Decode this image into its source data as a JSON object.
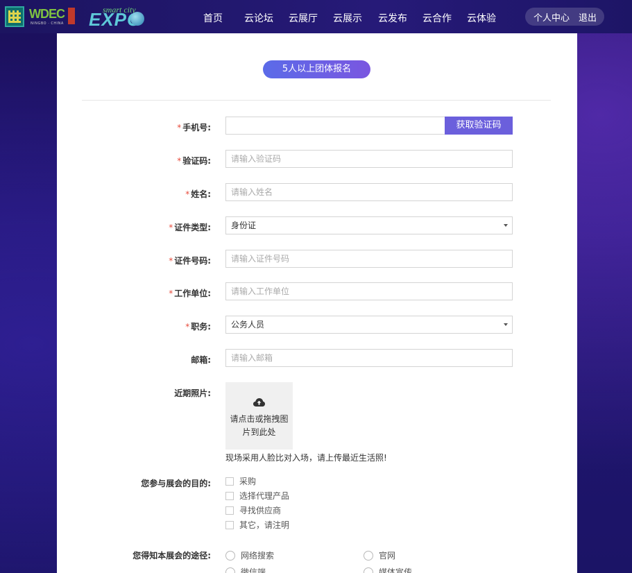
{
  "header": {
    "logo_wdec_text": "WDEC",
    "logo_wdec_sub": "NINGBO · CHINA",
    "logo_expo_small": "smart city",
    "logo_expo_text": "EXPO",
    "nav": [
      "首页",
      "云论坛",
      "云展厅",
      "云展示",
      "云发布",
      "云合作",
      "云体验"
    ],
    "user_center": "个人中心",
    "logout": "退出"
  },
  "form": {
    "title": "5人以上团体报名",
    "required_mark": "*",
    "phone_label": "手机号:",
    "phone_value": "",
    "get_code_button": "获取验证码",
    "code_label": "验证码:",
    "code_placeholder": "请输入验证码",
    "name_label": "姓名:",
    "name_placeholder": "请输入姓名",
    "id_type_label": "证件类型:",
    "id_type_value": "身份证",
    "id_number_label": "证件号码:",
    "id_number_placeholder": "请输入证件号码",
    "employer_label": "工作单位:",
    "employer_placeholder": "请输入工作单位",
    "position_label": "职务:",
    "position_value": "公务人员",
    "email_label": "邮箱:",
    "email_placeholder": "请输入邮箱",
    "photo_label": "近期照片:",
    "upload_text": "请点击或拖拽图片到此处",
    "photo_hint": "现场采用人脸比对入场，请上传最近生活照!",
    "purpose_label": "您参与展会的目的:",
    "purpose_options": [
      "采购",
      "选择代理产品",
      "寻找供应商",
      "其它，请注明"
    ],
    "source_label": "您得知本展会的途径:",
    "source_options": [
      "网络搜索",
      "官网",
      "微信端",
      "媒体宣传"
    ]
  },
  "colors": {
    "accent": "#6b5fdc",
    "required": "#e74c3c",
    "background": "#221673"
  }
}
